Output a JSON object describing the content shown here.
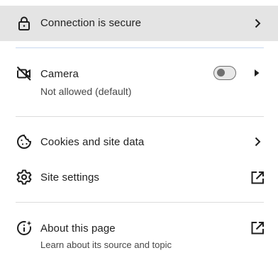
{
  "connection": {
    "label": "Connection is secure",
    "icon": "lock-icon"
  },
  "camera": {
    "label": "Camera",
    "status": "Not allowed (default)",
    "icon": "camera-off-icon",
    "toggle_on": false
  },
  "cookies": {
    "label": "Cookies and site data",
    "icon": "cookie-icon"
  },
  "site_settings": {
    "label": "Site settings",
    "icon": "gear-icon"
  },
  "about": {
    "label": "About this page",
    "description": "Learn about its source and topic",
    "icon": "info-sparkle-icon"
  }
}
